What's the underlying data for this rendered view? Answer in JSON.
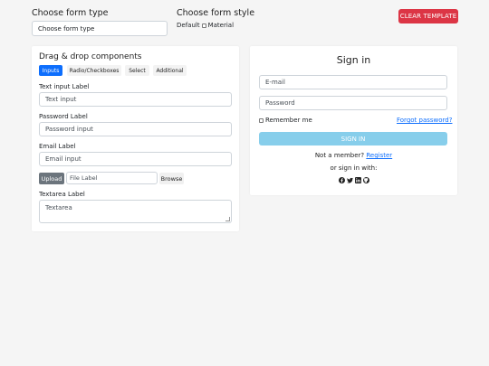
{
  "header": {
    "form_type_heading": "Choose form type",
    "form_type_value": "Choose form type",
    "form_style_heading": "Choose form style",
    "style_option_default": "Default",
    "style_option_material": "Material",
    "clear_template_label": "CLEAR TEMPLATE"
  },
  "components": {
    "title": "Drag & drop components",
    "tabs": [
      {
        "label": "Inputs",
        "active": true
      },
      {
        "label": "Radio/Checkboxes",
        "active": false
      },
      {
        "label": "Select",
        "active": false
      },
      {
        "label": "Additional",
        "active": false
      }
    ],
    "text_input": {
      "label": "Text input Label",
      "placeholder": "Text input"
    },
    "password_input": {
      "label": "Password Label",
      "placeholder": "Password input"
    },
    "email_input": {
      "label": "Email Label",
      "placeholder": "Email input"
    },
    "file": {
      "upload_label": "Upload",
      "placeholder": "File Label",
      "browse_label": "Browse"
    },
    "textarea": {
      "label": "Textarea Label",
      "placeholder": "Textarea"
    }
  },
  "signin": {
    "title": "Sign in",
    "email_placeholder": "E-mail",
    "password_placeholder": "Password",
    "remember_label": "Remember me",
    "forgot_label": "Forgot password?",
    "signin_button": "SIGN IN",
    "not_member_text": "Not a member?",
    "register_label": "Register",
    "or_signin_text": "or sign in with:",
    "social_icons": [
      "facebook-icon",
      "twitter-icon",
      "linkedin-icon",
      "github-icon"
    ]
  },
  "colors": {
    "accent": "#0d6efd",
    "danger": "#dc3545",
    "signin_button": "#87ceeb",
    "upload_button": "#6c757d"
  }
}
